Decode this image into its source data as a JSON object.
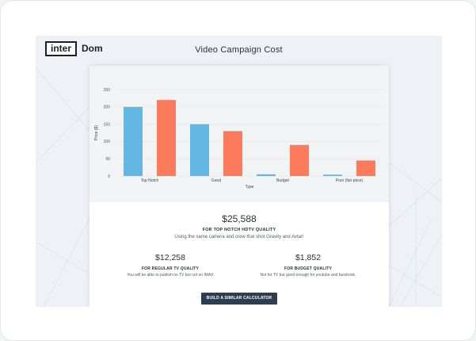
{
  "app": {
    "logo_left": "inter",
    "logo_right": "Dom",
    "title": "Video Campaign Cost"
  },
  "chart_data": {
    "type": "bar",
    "categories": [
      "Top Notch",
      "Good",
      "Budget",
      "Poor (fair price)"
    ],
    "series": [
      {
        "color": "#63b7e3",
        "values": [
          200,
          150,
          5,
          4
        ]
      },
      {
        "color": "#fb7b5c",
        "values": [
          220,
          130,
          90,
          45
        ]
      }
    ],
    "xlabel": "Type",
    "ylabel": "Price ($)",
    "ylim": [
      0,
      250
    ],
    "yticks": [
      0,
      50,
      100,
      150,
      200,
      250
    ],
    "grid": true
  },
  "results": {
    "main": {
      "price": "$25,588",
      "label": "FOR TOP NOTCH HDTV QUALITY",
      "desc": "Using the same camera and crew that shot Gravity and Avtar!"
    },
    "left": {
      "price": "$12,258",
      "label": "FOR REGULAR TV QUALITY",
      "desc": "You will be able to publish on TV but not on IMAX"
    },
    "right": {
      "price": "$1,852",
      "label": "FOR BUDGET QUALITY",
      "desc": "Not for TV but good enough for youtube and facebook."
    }
  },
  "cta": {
    "label": "BUILD A SIMILAR CALCULATOR"
  }
}
